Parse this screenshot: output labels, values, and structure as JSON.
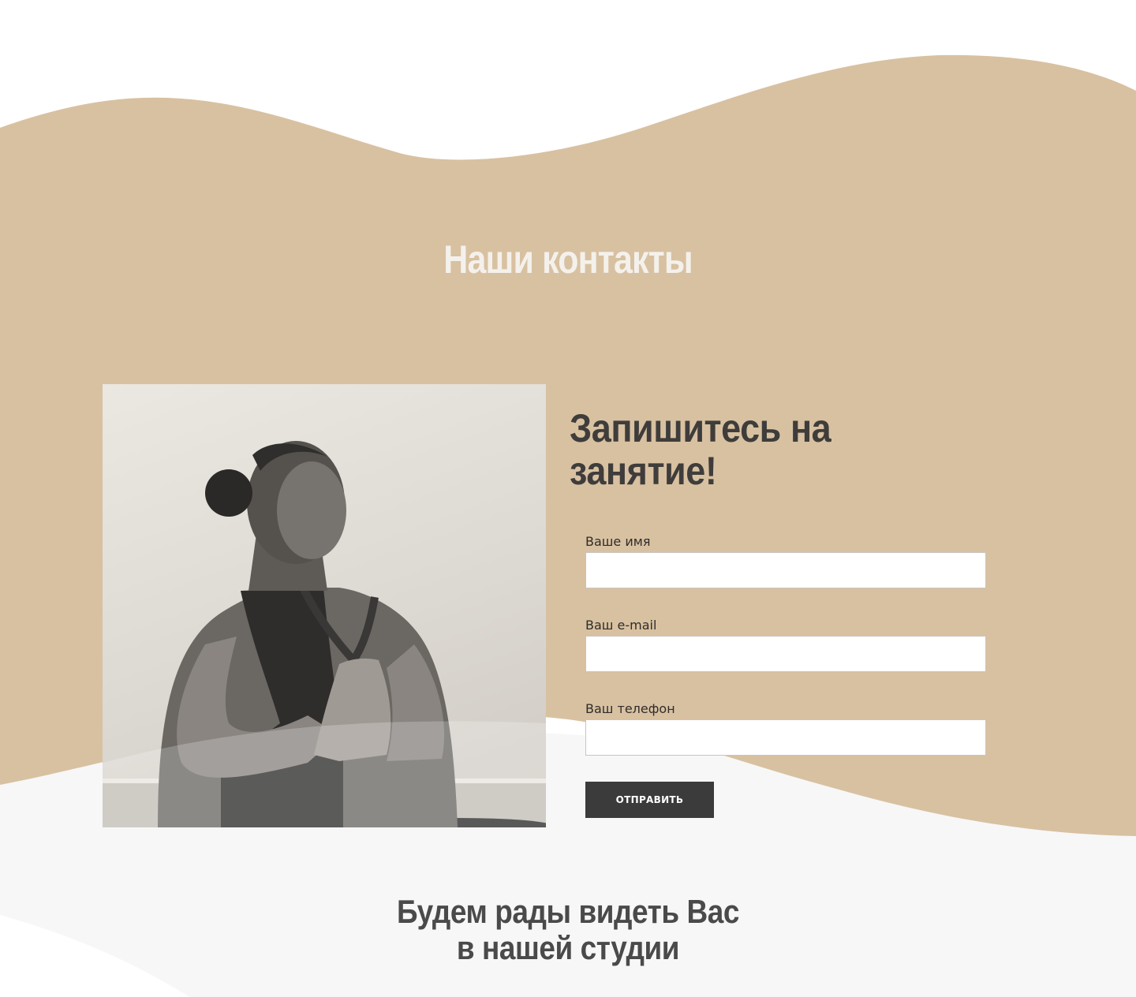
{
  "colors": {
    "beige": "#d8c1a1",
    "light_gray": "#f7f7f7",
    "button_bg": "#3b3b3b",
    "title_light": "#f4f1ec",
    "text_dark": "#3f3d3b"
  },
  "contacts": {
    "title": "Наши контакты"
  },
  "signup": {
    "image_icon": "yoga-photo",
    "title": "Запишитесь на занятие!",
    "fields": [
      {
        "label": "Ваше имя",
        "value": "",
        "placeholder": ""
      },
      {
        "label": "Ваш e-mail",
        "value": "",
        "placeholder": ""
      },
      {
        "label": "Ваш телефон",
        "value": "",
        "placeholder": ""
      }
    ],
    "submit_label": "ОТПРАВИТЬ"
  },
  "footer": {
    "line1": "Будем рады видеть Вас",
    "line2": "в нашей студии"
  }
}
